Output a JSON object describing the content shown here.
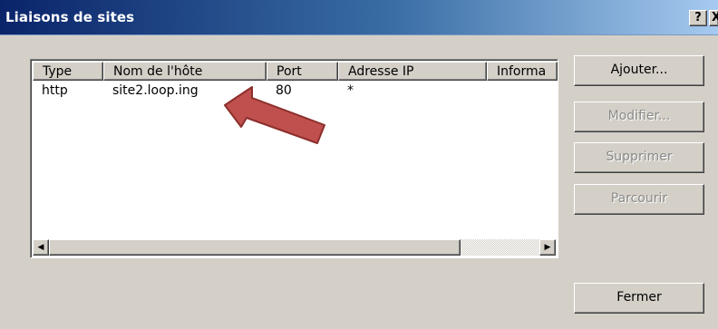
{
  "window": {
    "title": "Liaisons de sites",
    "help_label": "?",
    "close_label": "X"
  },
  "bindings_table": {
    "columns": [
      "Type",
      "Nom de l'hôte",
      "Port",
      "Adresse IP",
      "Informa"
    ],
    "rows": [
      {
        "type": "http",
        "host": "site2.loop.ing",
        "port": "80",
        "ip": "*",
        "info": ""
      }
    ]
  },
  "scrollbar": {
    "left_arrow": "◀",
    "right_arrow": "▶"
  },
  "buttons": {
    "add": "Ajouter...",
    "edit": "Modifier...",
    "delete": "Supprimer",
    "browse": "Parcourir",
    "close": "Fermer"
  },
  "annotation": {
    "arrow_color": "#c0504d",
    "arrow_stroke": "#8c2f2c"
  }
}
